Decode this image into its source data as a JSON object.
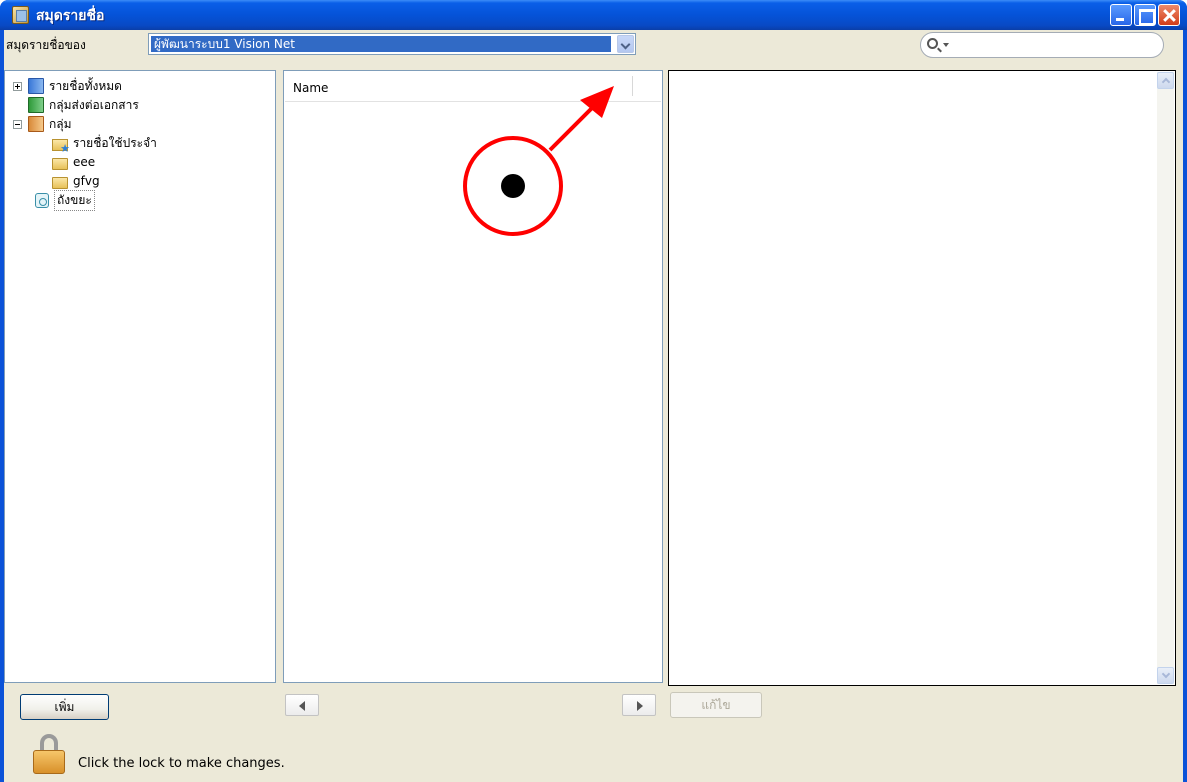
{
  "window": {
    "title": "สมุดรายชื่อ"
  },
  "owner": {
    "label": "สมุดรายชื่อของ",
    "selected": "ผู้พัฒนาระบบ1 Vision Net"
  },
  "search": {
    "placeholder": ""
  },
  "tree": {
    "items": [
      {
        "label": "รายชื่อทั้งหมด",
        "icon": "address-book-icon"
      },
      {
        "label": "กลุ่มส่งต่อเอกสาร",
        "icon": "forward-group-icon"
      },
      {
        "label": "กลุ่ม",
        "icon": "group-book-icon"
      },
      {
        "label": "รายชื่อใช้ประจำ",
        "icon": "favorite-folder-icon"
      },
      {
        "label": "eee",
        "icon": "folder-icon"
      },
      {
        "label": "gfvg",
        "icon": "folder-icon"
      },
      {
        "label": "ถังขยะ",
        "icon": "trash-icon"
      }
    ]
  },
  "list": {
    "column_name": "Name"
  },
  "buttons": {
    "add": "เพิ่ม",
    "edit": "แก้ไข"
  },
  "footer": {
    "lock_text": "Click the lock to make changes."
  },
  "colors": {
    "titlebar": "#0553d8",
    "annotation": "#ff0000",
    "selection": "#316ac5"
  }
}
